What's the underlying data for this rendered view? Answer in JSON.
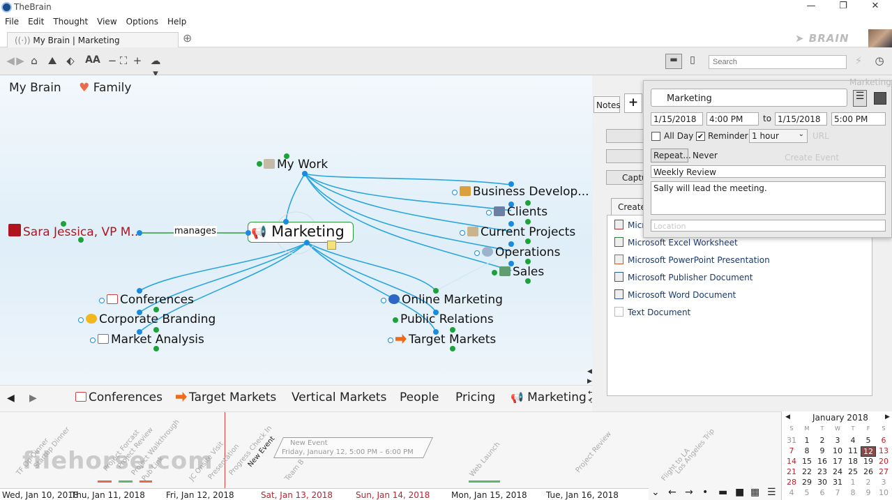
{
  "window": {
    "title": "TheBrain"
  },
  "menu": [
    "File",
    "Edit",
    "Thought",
    "View",
    "Options",
    "Help"
  ],
  "tab": {
    "label": "My Brain | Marketing"
  },
  "search": {
    "placeholder": "Search"
  },
  "breadcrumb": {
    "root": "My Brain",
    "favorite": "Family"
  },
  "mindmap": {
    "active": "Marketing",
    "parent": "My Work",
    "link_label": "manages",
    "jump": "Sara Jessica, VP M...",
    "right_children": [
      "Business Develop...",
      "Clients",
      "Current Projects",
      "Operations",
      "Sales"
    ],
    "left_children": [
      "Conferences",
      "Corporate Branding",
      "Market Analysis"
    ],
    "mid_children": [
      "Online Marketing",
      "Public Relations",
      "Target Markets"
    ]
  },
  "plex_history": [
    "Conferences",
    "Target Markets",
    "Vertical Markets",
    "People",
    "Pricing",
    "Marketing"
  ],
  "side": {
    "notes_tab": "Notes",
    "add_tab": "+",
    "create_tab": "Create",
    "capture_btn": "Captu"
  },
  "files": [
    "Microsoft Access Database",
    "Microsoft Excel Worksheet",
    "Microsoft PowerPoint Presentation",
    "Microsoft Publisher Document",
    "Microsoft Word Document",
    "Text Document"
  ],
  "files_visible_first": "Micr",
  "event": {
    "title": "Marketing",
    "start_date": "1/15/2018",
    "start_time": "4:00 PM",
    "to_label": "to",
    "end_date": "1/15/2018",
    "end_time": "5:00 PM",
    "all_day": "All Day",
    "reminder": "Reminder",
    "reminder_value": "1 hour",
    "repeat_btn": "Repeat...",
    "repeat_value": "Never",
    "subject": "Weekly Review",
    "notes": "Sally will lead the meeting.",
    "location_placeholder": "Location",
    "url_placeholder": "URL",
    "create_event": "Create Event",
    "header_faded": "Marketing"
  },
  "timeline": {
    "dates": [
      "Wed, Jan 10, 2018",
      "Thu, Jan 11, 2018",
      "Fri, Jan 12, 2018",
      "Sat, Jan 13, 2018",
      "Sun, Jan 14, 2018",
      "Mon, Jan 15, 2018",
      "Tue, Jan 16, 2018"
    ],
    "new_event_title": "New Event",
    "new_event_time": "Friday, January 12, 5:00 PM – 6:00 PM",
    "events": [
      "TF Op Dinner",
      "Startup Dinner",
      "Project Forcast",
      "Project Review",
      "Project Walkthrough",
      "Pub Link",
      "JC Onsite Visit",
      "Presentation",
      "Progress Check In",
      "New Event",
      "Team B",
      "Web Launch",
      "Project Review",
      "Flight to LA",
      "Los Angeles Trip"
    ],
    "weekend_color": "#c0202a"
  },
  "calendar": {
    "month": "January 2018",
    "weekdays": [
      "S",
      "M",
      "T",
      "W",
      "T",
      "F",
      "S"
    ],
    "weeks": [
      [
        "31",
        "1",
        "2",
        "3",
        "4",
        "5",
        "6"
      ],
      [
        "7",
        "8",
        "9",
        "10",
        "11",
        "12",
        "13"
      ],
      [
        "14",
        "15",
        "16",
        "17",
        "18",
        "19",
        "20"
      ],
      [
        "21",
        "22",
        "23",
        "24",
        "25",
        "26",
        "27"
      ],
      [
        "28",
        "29",
        "30",
        "31",
        "1",
        "2",
        "3"
      ],
      [
        "4",
        "5",
        "6",
        "7",
        "8",
        "9",
        "10"
      ]
    ],
    "selected": "12"
  },
  "watermark": "filehorse.com",
  "colors": {
    "accent": "#1b8be0",
    "node_green": "#1aa33a",
    "jump_red": "#b0151f"
  }
}
